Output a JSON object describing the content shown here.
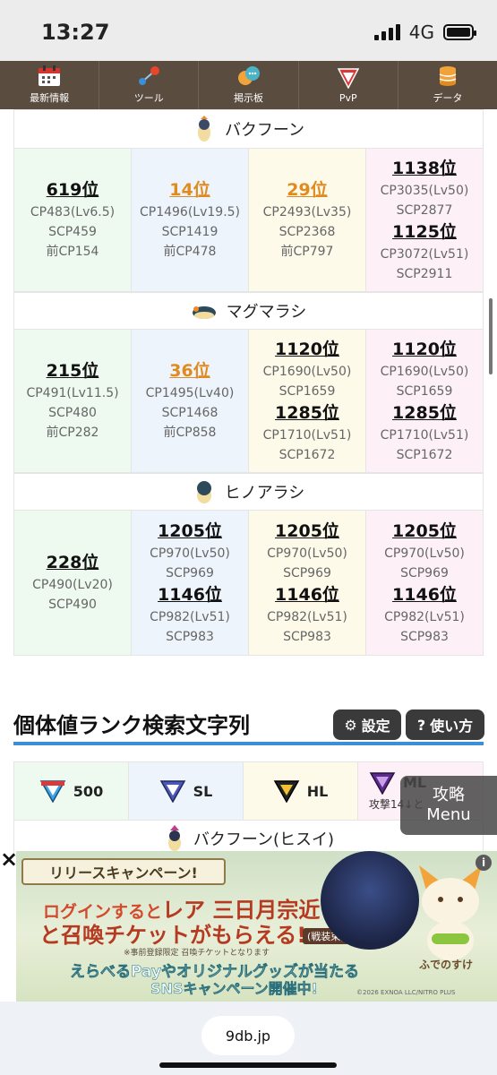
{
  "status": {
    "time": "13:27",
    "network": "4G"
  },
  "nav": [
    {
      "label": "最新情報",
      "icon": "calendar-icon"
    },
    {
      "label": "ツール",
      "icon": "tool-icon"
    },
    {
      "label": "掲示板",
      "icon": "chat-icon"
    },
    {
      "label": "PvP",
      "icon": "pvp-icon"
    },
    {
      "label": "データ",
      "icon": "database-icon"
    }
  ],
  "pokemon": [
    {
      "name": "バクフーン",
      "cells": [
        [
          {
            "rank": "619位"
          },
          {
            "t": "CP483(Lv6.5)"
          },
          {
            "t": "SCP459"
          },
          {
            "t": "前CP154"
          }
        ],
        [
          {
            "rank": "14位",
            "hl": true
          },
          {
            "t": "CP1496(Lv19.5)"
          },
          {
            "t": "SCP1419"
          },
          {
            "t": "前CP478"
          }
        ],
        [
          {
            "rank": "29位",
            "hl": true
          },
          {
            "t": "CP2493(Lv35)"
          },
          {
            "t": "SCP2368"
          },
          {
            "t": "前CP797"
          }
        ],
        [
          {
            "rank": "1138位"
          },
          {
            "t": "CP3035(Lv50)"
          },
          {
            "t": "SCP2877"
          },
          {
            "rank": "1125位"
          },
          {
            "t": "CP3072(Lv51)"
          },
          {
            "t": "SCP2911"
          }
        ]
      ]
    },
    {
      "name": "マグマラシ",
      "cells": [
        [
          {
            "rank": "215位"
          },
          {
            "t": "CP491(Lv11.5)"
          },
          {
            "t": "SCP480"
          },
          {
            "t": "前CP282"
          }
        ],
        [
          {
            "rank": "36位",
            "hl": true
          },
          {
            "t": "CP1495(Lv40)"
          },
          {
            "t": "SCP1468"
          },
          {
            "t": "前CP858"
          }
        ],
        [
          {
            "rank": "1120位"
          },
          {
            "t": "CP1690(Lv50)"
          },
          {
            "t": "SCP1659"
          },
          {
            "rank": "1285位"
          },
          {
            "t": "CP1710(Lv51)"
          },
          {
            "t": "SCP1672"
          }
        ],
        [
          {
            "rank": "1120位"
          },
          {
            "t": "CP1690(Lv50)"
          },
          {
            "t": "SCP1659"
          },
          {
            "rank": "1285位"
          },
          {
            "t": "CP1710(Lv51)"
          },
          {
            "t": "SCP1672"
          }
        ]
      ]
    },
    {
      "name": "ヒノアラシ",
      "cells": [
        [
          {
            "rank": "228位"
          },
          {
            "t": "CP490(Lv20)"
          },
          {
            "t": "SCP490"
          }
        ],
        [
          {
            "rank": "1205位"
          },
          {
            "t": "CP970(Lv50)"
          },
          {
            "t": "SCP969"
          },
          {
            "rank": "1146位"
          },
          {
            "t": "CP982(Lv51)"
          },
          {
            "t": "SCP983"
          }
        ],
        [
          {
            "rank": "1205位"
          },
          {
            "t": "CP970(Lv50)"
          },
          {
            "t": "SCP969"
          },
          {
            "rank": "1146位"
          },
          {
            "t": "CP982(Lv51)"
          },
          {
            "t": "SCP983"
          }
        ],
        [
          {
            "rank": "1205位"
          },
          {
            "t": "CP970(Lv50)"
          },
          {
            "t": "SCP969"
          },
          {
            "rank": "1146位"
          },
          {
            "t": "CP982(Lv51)"
          },
          {
            "t": "SCP983"
          }
        ]
      ]
    }
  ],
  "search": {
    "title": "個体値ランク検索文字列",
    "settings_label": "設定",
    "help_label": "使い方",
    "leagues": [
      "500",
      "SL",
      "HL",
      "ML"
    ],
    "ml_sub": "攻撃14↓と",
    "next_pokemon": "バクフーン(ヒスイ)"
  },
  "guide": {
    "line1": "攻略",
    "line2": "Menu"
  },
  "ad": {
    "close": "×",
    "info": "i",
    "banner": "リリースキャンペーン!",
    "line1a": "ログインすると",
    "line1b": "レア 三日月宗近",
    "line2": "と召喚チケットがもらえる!",
    "tag": "(戦装束)",
    "sub": "※事前登録限定 召喚チケットとなります",
    "line3": "えらべるPayやオリジナルグッズが当たる",
    "line4": "SNSキャンペーン開催中!",
    "mascot": "ふでのすけ",
    "copyright": "©2026 EXNOA LLC/NITRO PLUS"
  },
  "browser": {
    "url": "9db.jp"
  },
  "colors": {
    "gl_bg": "#eefaef",
    "sl_bg": "#eef4fc",
    "hl_bg": "#fdfaea",
    "ml_bg": "#fdf1f7",
    "rank_highlight": "#e08a1f",
    "accent_line": "#3c8ed6",
    "nav_bg": "#5a4c3f"
  }
}
